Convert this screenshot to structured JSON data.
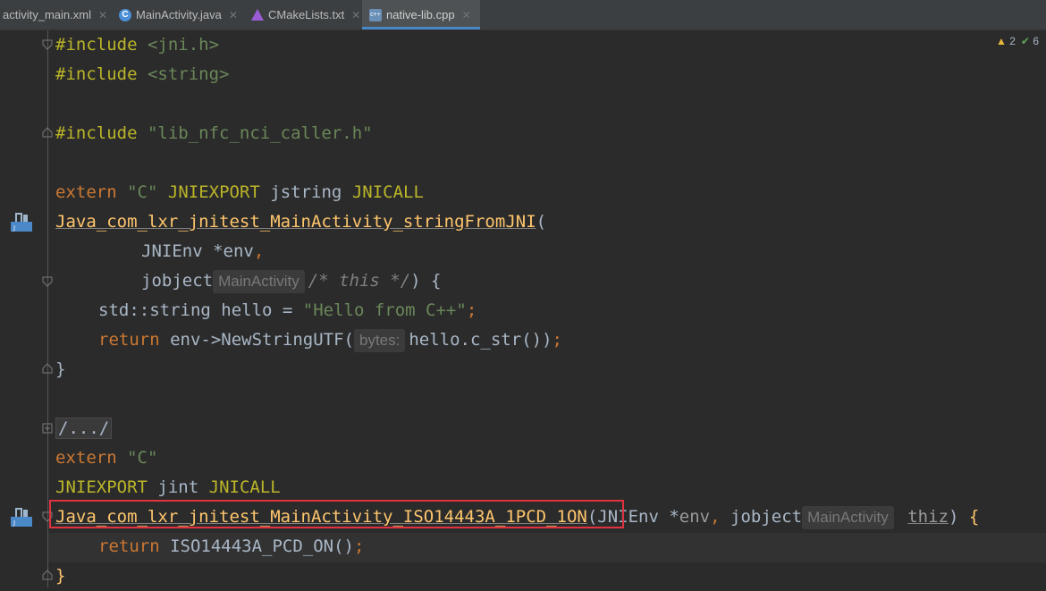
{
  "tabs": [
    {
      "label": "activity_main.xml",
      "icon": "xml-file-icon"
    },
    {
      "label": "MainActivity.java",
      "icon": "java-class-icon"
    },
    {
      "label": "CMakeLists.txt",
      "icon": "cmake-icon"
    },
    {
      "label": "native-lib.cpp",
      "icon": "cpp-file-icon",
      "active": true
    }
  ],
  "inspections": {
    "warnings": "2",
    "checks": "6"
  },
  "code": {
    "l1_kw": "#include",
    "l1_str": "<jni.h>",
    "l2_kw": "#include",
    "l2_str": "<string>",
    "l3_kw": "#include",
    "l3_str": "\"lib_nfc_nci_caller.h\"",
    "l4_extern": "extern",
    "l4_c": "\"C\"",
    "l4_export": "JNIEXPORT",
    "l4_type": "jstring",
    "l4_call": "JNICALL",
    "l5_fn": "Java_com_lxr_jnitest_MainActivity_stringFromJNI",
    "l5_paren": "(",
    "l6_type": "JNIEnv *env",
    "l6_comma": ",",
    "l7_type": "jobject",
    "l7_hint": "MainActivity",
    "l7_comment": "/* this */",
    "l7_tail": ") {",
    "l8_a": "std::string hello = ",
    "l8_str": "\"Hello from C++\"",
    "l8_semi": ";",
    "l9_ret": "return",
    "l9_call": "env->NewStringUTF(",
    "l9_hint": "bytes:",
    "l9_arg": "hello.c_str())",
    "l9_semi": ";",
    "l10": "}",
    "l11": "/.../",
    "l12_extern": "extern",
    "l12_c": "\"C\"",
    "l13_export": "JNIEXPORT",
    "l13_type": "jint",
    "l13_call": "JNICALL",
    "l14_fn": "Java_com_lxr_jnitest_MainActivity_ISO14443A_1PCD_1ON",
    "l14_paren": "(JNIEnv *",
    "l14_env": "env",
    "l14_comma": ", ",
    "l14_obj": "jobject",
    "l14_hint": "MainActivity",
    "l14_thiz": "thiz",
    "l14_tail": ") ",
    "l14_brace": "{",
    "l15_ret": "return",
    "l15_call": "ISO14443A_PCD_ON()",
    "l15_semi": ";",
    "l16": "}"
  }
}
